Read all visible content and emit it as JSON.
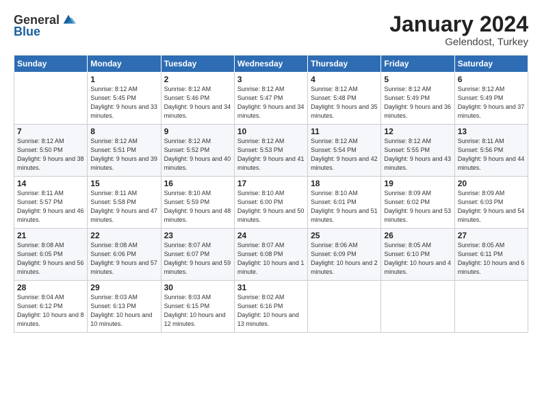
{
  "logo": {
    "general": "General",
    "blue": "Blue"
  },
  "header": {
    "month": "January 2024",
    "location": "Gelendost, Turkey"
  },
  "weekdays": [
    "Sunday",
    "Monday",
    "Tuesday",
    "Wednesday",
    "Thursday",
    "Friday",
    "Saturday"
  ],
  "weeks": [
    [
      {
        "day": "",
        "sunrise": "",
        "sunset": "",
        "daylight": ""
      },
      {
        "day": "1",
        "sunrise": "Sunrise: 8:12 AM",
        "sunset": "Sunset: 5:45 PM",
        "daylight": "Daylight: 9 hours and 33 minutes."
      },
      {
        "day": "2",
        "sunrise": "Sunrise: 8:12 AM",
        "sunset": "Sunset: 5:46 PM",
        "daylight": "Daylight: 9 hours and 34 minutes."
      },
      {
        "day": "3",
        "sunrise": "Sunrise: 8:12 AM",
        "sunset": "Sunset: 5:47 PM",
        "daylight": "Daylight: 9 hours and 34 minutes."
      },
      {
        "day": "4",
        "sunrise": "Sunrise: 8:12 AM",
        "sunset": "Sunset: 5:48 PM",
        "daylight": "Daylight: 9 hours and 35 minutes."
      },
      {
        "day": "5",
        "sunrise": "Sunrise: 8:12 AM",
        "sunset": "Sunset: 5:49 PM",
        "daylight": "Daylight: 9 hours and 36 minutes."
      },
      {
        "day": "6",
        "sunrise": "Sunrise: 8:12 AM",
        "sunset": "Sunset: 5:49 PM",
        "daylight": "Daylight: 9 hours and 37 minutes."
      }
    ],
    [
      {
        "day": "7",
        "sunrise": "Sunrise: 8:12 AM",
        "sunset": "Sunset: 5:50 PM",
        "daylight": "Daylight: 9 hours and 38 minutes."
      },
      {
        "day": "8",
        "sunrise": "Sunrise: 8:12 AM",
        "sunset": "Sunset: 5:51 PM",
        "daylight": "Daylight: 9 hours and 39 minutes."
      },
      {
        "day": "9",
        "sunrise": "Sunrise: 8:12 AM",
        "sunset": "Sunset: 5:52 PM",
        "daylight": "Daylight: 9 hours and 40 minutes."
      },
      {
        "day": "10",
        "sunrise": "Sunrise: 8:12 AM",
        "sunset": "Sunset: 5:53 PM",
        "daylight": "Daylight: 9 hours and 41 minutes."
      },
      {
        "day": "11",
        "sunrise": "Sunrise: 8:12 AM",
        "sunset": "Sunset: 5:54 PM",
        "daylight": "Daylight: 9 hours and 42 minutes."
      },
      {
        "day": "12",
        "sunrise": "Sunrise: 8:12 AM",
        "sunset": "Sunset: 5:55 PM",
        "daylight": "Daylight: 9 hours and 43 minutes."
      },
      {
        "day": "13",
        "sunrise": "Sunrise: 8:11 AM",
        "sunset": "Sunset: 5:56 PM",
        "daylight": "Daylight: 9 hours and 44 minutes."
      }
    ],
    [
      {
        "day": "14",
        "sunrise": "Sunrise: 8:11 AM",
        "sunset": "Sunset: 5:57 PM",
        "daylight": "Daylight: 9 hours and 46 minutes."
      },
      {
        "day": "15",
        "sunrise": "Sunrise: 8:11 AM",
        "sunset": "Sunset: 5:58 PM",
        "daylight": "Daylight: 9 hours and 47 minutes."
      },
      {
        "day": "16",
        "sunrise": "Sunrise: 8:10 AM",
        "sunset": "Sunset: 5:59 PM",
        "daylight": "Daylight: 9 hours and 48 minutes."
      },
      {
        "day": "17",
        "sunrise": "Sunrise: 8:10 AM",
        "sunset": "Sunset: 6:00 PM",
        "daylight": "Daylight: 9 hours and 50 minutes."
      },
      {
        "day": "18",
        "sunrise": "Sunrise: 8:10 AM",
        "sunset": "Sunset: 6:01 PM",
        "daylight": "Daylight: 9 hours and 51 minutes."
      },
      {
        "day": "19",
        "sunrise": "Sunrise: 8:09 AM",
        "sunset": "Sunset: 6:02 PM",
        "daylight": "Daylight: 9 hours and 53 minutes."
      },
      {
        "day": "20",
        "sunrise": "Sunrise: 8:09 AM",
        "sunset": "Sunset: 6:03 PM",
        "daylight": "Daylight: 9 hours and 54 minutes."
      }
    ],
    [
      {
        "day": "21",
        "sunrise": "Sunrise: 8:08 AM",
        "sunset": "Sunset: 6:05 PM",
        "daylight": "Daylight: 9 hours and 56 minutes."
      },
      {
        "day": "22",
        "sunrise": "Sunrise: 8:08 AM",
        "sunset": "Sunset: 6:06 PM",
        "daylight": "Daylight: 9 hours and 57 minutes."
      },
      {
        "day": "23",
        "sunrise": "Sunrise: 8:07 AM",
        "sunset": "Sunset: 6:07 PM",
        "daylight": "Daylight: 9 hours and 59 minutes."
      },
      {
        "day": "24",
        "sunrise": "Sunrise: 8:07 AM",
        "sunset": "Sunset: 6:08 PM",
        "daylight": "Daylight: 10 hours and 1 minute."
      },
      {
        "day": "25",
        "sunrise": "Sunrise: 8:06 AM",
        "sunset": "Sunset: 6:09 PM",
        "daylight": "Daylight: 10 hours and 2 minutes."
      },
      {
        "day": "26",
        "sunrise": "Sunrise: 8:05 AM",
        "sunset": "Sunset: 6:10 PM",
        "daylight": "Daylight: 10 hours and 4 minutes."
      },
      {
        "day": "27",
        "sunrise": "Sunrise: 8:05 AM",
        "sunset": "Sunset: 6:11 PM",
        "daylight": "Daylight: 10 hours and 6 minutes."
      }
    ],
    [
      {
        "day": "28",
        "sunrise": "Sunrise: 8:04 AM",
        "sunset": "Sunset: 6:12 PM",
        "daylight": "Daylight: 10 hours and 8 minutes."
      },
      {
        "day": "29",
        "sunrise": "Sunrise: 8:03 AM",
        "sunset": "Sunset: 6:13 PM",
        "daylight": "Daylight: 10 hours and 10 minutes."
      },
      {
        "day": "30",
        "sunrise": "Sunrise: 8:03 AM",
        "sunset": "Sunset: 6:15 PM",
        "daylight": "Daylight: 10 hours and 12 minutes."
      },
      {
        "day": "31",
        "sunrise": "Sunrise: 8:02 AM",
        "sunset": "Sunset: 6:16 PM",
        "daylight": "Daylight: 10 hours and 13 minutes."
      },
      {
        "day": "",
        "sunrise": "",
        "sunset": "",
        "daylight": ""
      },
      {
        "day": "",
        "sunrise": "",
        "sunset": "",
        "daylight": ""
      },
      {
        "day": "",
        "sunrise": "",
        "sunset": "",
        "daylight": ""
      }
    ]
  ]
}
